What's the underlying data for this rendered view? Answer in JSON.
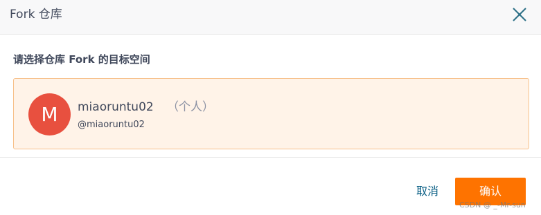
{
  "dialog": {
    "title": "Fork 仓库",
    "close_icon": "close-icon",
    "section_label": "请选择仓库 Fork 的目标空间"
  },
  "namespace": {
    "avatar_letter": "M",
    "avatar_color": "#e8503f",
    "name": "miaoruntu02",
    "type": "（个人）",
    "path": "@miaoruntu02"
  },
  "actions": {
    "cancel_label": "取消",
    "confirm_label": "确认",
    "confirm_color": "#fe7300",
    "cancel_color": "#005980"
  },
  "watermark": "CSDN @ _-Mr-sun"
}
